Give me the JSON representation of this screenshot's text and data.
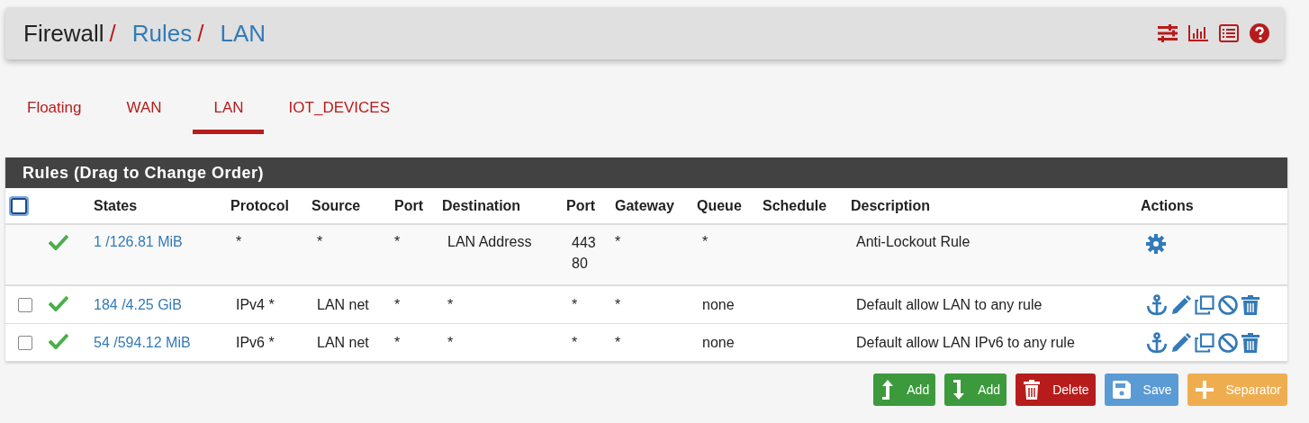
{
  "breadcrumb_separator": "/",
  "breadcrumb": [
    {
      "label": "Firewall",
      "link": false
    },
    {
      "label": "Rules",
      "link": true
    },
    {
      "label": "LAN",
      "link": true
    }
  ],
  "tabs": [
    {
      "label": "Floating",
      "selected": false
    },
    {
      "label": "WAN",
      "selected": false
    },
    {
      "label": "LAN",
      "selected": true
    },
    {
      "label": "IOT_DEVICES",
      "selected": false
    }
  ],
  "panel_title": "Rules (Drag to Change Order)",
  "select_all": {
    "checked": false
  },
  "columns": [
    "States",
    "Protocol",
    "Source",
    "Port",
    "Destination",
    "Port",
    "Gateway",
    "Queue",
    "Schedule",
    "Description",
    "Actions"
  ],
  "rows": [
    {
      "kind": "locked",
      "enabled": true,
      "states": "1 /126.81 MiB",
      "protocol": "*",
      "source": "*",
      "source_port": "*",
      "destination": "LAN Address",
      "dest_port": [
        "443",
        "80"
      ],
      "gateway": "*",
      "queue": "*",
      "description": "Anti-Lockout Rule"
    },
    {
      "kind": "rule",
      "checked": false,
      "enabled": true,
      "states": "184 /4.25 GiB",
      "protocol": "IPv4 *",
      "source": "LAN net",
      "source_port": "*",
      "destination": "*",
      "dest_port": [
        "*"
      ],
      "gateway": "*",
      "queue": "none",
      "description": "Default allow LAN to any rule"
    },
    {
      "kind": "rule",
      "checked": false,
      "enabled": true,
      "states": "54 /594.12 MiB",
      "protocol": "IPv6 *",
      "source": "LAN net",
      "source_port": "*",
      "destination": "*",
      "dest_port": [
        "*"
      ],
      "gateway": "*",
      "queue": "none",
      "description": "Default allow LAN IPv6 to any rule"
    }
  ],
  "buttons": [
    {
      "kind": "add_top",
      "label": "Add"
    },
    {
      "kind": "add_bottom",
      "label": "Add"
    },
    {
      "kind": "delete",
      "label": "Delete"
    },
    {
      "kind": "save",
      "label": "Save"
    },
    {
      "kind": "separator",
      "label": "Separator"
    }
  ]
}
